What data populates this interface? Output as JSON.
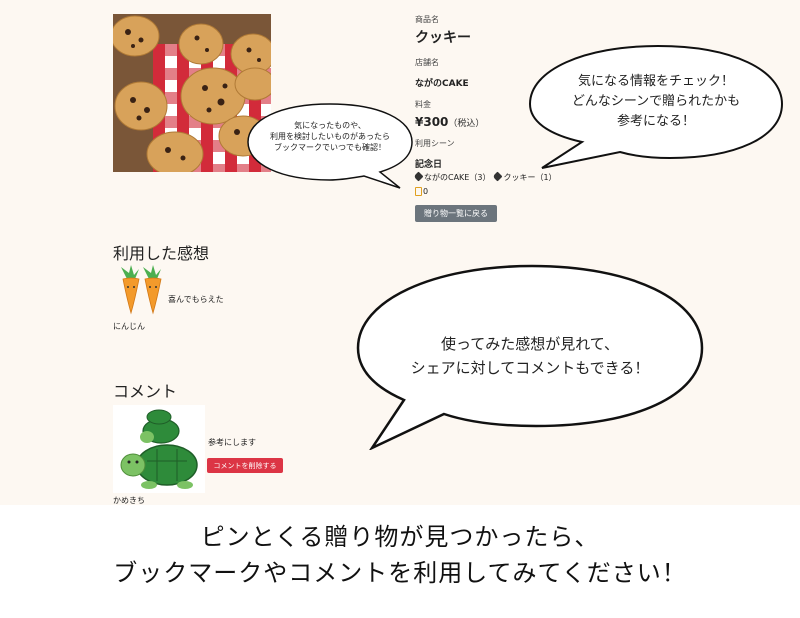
{
  "product": {
    "name_label": "商品名",
    "name": "クッキー",
    "shop_label": "店舗名",
    "shop": "ながのCAKE",
    "price_label": "料金",
    "price": "¥300",
    "price_tax": "（税込）",
    "scene_label": "利用シーン",
    "scene": "記念日",
    "tags": [
      "ながのCAKE（3）",
      "クッキー（1）"
    ],
    "bookmark_count": "0",
    "back_button": "贈り物一覧に戻る",
    "image_icon": "cookie-photo"
  },
  "reviews": {
    "title": "利用した感想",
    "items": [
      {
        "text": "喜んでもらえた",
        "user": "にんじん",
        "avatar_icon": "carrot-icon"
      }
    ]
  },
  "comments": {
    "title": "コメント",
    "items": [
      {
        "text": "参考にします",
        "delete_button": "コメントを削除する",
        "user": "かめきち",
        "avatar_icon": "turtle-icon"
      }
    ]
  },
  "bubbles": {
    "bookmark_note": "気になったものや、\n利用を検討したいものがあったら\nブックマークでいつでも確認！",
    "info_note": "気になる情報をチェック！\nどんなシーンで贈られたかも\n参考になる！",
    "review_note": "使ってみた感想が見れて、\nシェアに対してコメントもできる！"
  },
  "caption": {
    "line1": "ピンとくる贈り物が見つかったら、",
    "line2": "ブックマークやコメントを利用してみてください！"
  },
  "colors": {
    "page_bg": "#fdf8f2",
    "back_button": "#6c757d",
    "delete_button": "#dc3545",
    "bookmark_icon": "#e0a020"
  }
}
